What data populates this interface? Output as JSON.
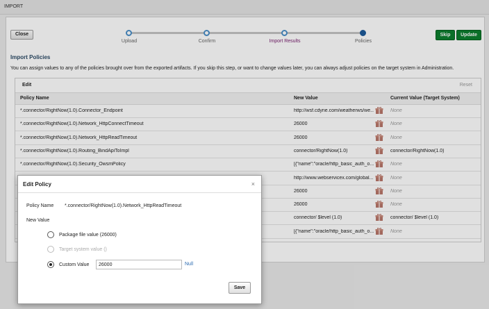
{
  "window": {
    "title": "IMPORT"
  },
  "toolbar": {
    "close_label": "Close",
    "skip_label": "Skip",
    "update_label": "Update"
  },
  "train": {
    "steps": [
      {
        "label": "Upload",
        "state": "done"
      },
      {
        "label": "Confirm",
        "state": "done"
      },
      {
        "label": "Import Results",
        "state": "visited"
      },
      {
        "label": "Policies",
        "state": "current"
      }
    ]
  },
  "section": {
    "title": "Import Policies",
    "description": "You can assign values to any of the policies brought over from the exported artifacts. If you skip this step, or want to change values later, you can always adjust policies on the target system in Administration."
  },
  "table": {
    "edit_label": "Edit",
    "reset_label": "Reset",
    "columns": [
      "Policy Name",
      "New Value",
      "Current Value (Target System)"
    ],
    "rows": [
      {
        "name": "*.connector/RightNow(1.0).Connector_Endpoint",
        "new_value": "http://wsf.cdyne.com/weatherws/we...",
        "current": "None",
        "current_is_none": true
      },
      {
        "name": "*.connector/RightNow(1.0).Network_HttpConnectTimeout",
        "new_value": "26000",
        "current": "None",
        "current_is_none": true
      },
      {
        "name": "*.connector/RightNow(1.0).Network_HttpReadTimeout",
        "new_value": "26000",
        "current": "None",
        "current_is_none": true
      },
      {
        "name": "*.connector/RightNow(1.0).Routing_BindApiToImpl",
        "new_value": "connector/RightNow(1.0)",
        "current": "connector/RightNow(1.0)",
        "current_is_none": false
      },
      {
        "name": "*.connector/RightNow(1.0).Security_OwsmPolicy",
        "new_value": "[{\"name\":\"oracle/http_basic_auth_o...",
        "current": "None",
        "current_is_none": true
      },
      {
        "name": "",
        "new_value": "http://www.webservicex.com/global...",
        "current": "None",
        "current_is_none": true
      },
      {
        "name": "",
        "new_value": "26000",
        "current": "None",
        "current_is_none": true
      },
      {
        "name": "",
        "new_value": "26000",
        "current": "None",
        "current_is_none": true
      },
      {
        "name": "",
        "new_value": "connector/ $level (1.0)",
        "current": "connector/ $level (1.0)",
        "current_is_none": false
      },
      {
        "name": "",
        "new_value": "[{\"name\":\"oracle/http_basic_auth_o...",
        "current": "None",
        "current_is_none": true
      }
    ]
  },
  "dialog": {
    "title": "Edit Policy",
    "close_glyph": "×",
    "policy_name_label": "Policy Name",
    "policy_name_value": "*.connector/RightNow(1.0).Network_HttpReadTimeout",
    "new_value_label": "New Value",
    "options": [
      {
        "label": "Package file value (26000)",
        "selected": false,
        "enabled": true
      },
      {
        "label": "Target system value ()",
        "selected": false,
        "enabled": false
      },
      {
        "label": "Custom Value",
        "selected": true,
        "enabled": true
      }
    ],
    "custom_value": "26000",
    "null_link": "Null",
    "save_label": "Save"
  },
  "colors": {
    "accent_green": "#0c7f2e",
    "train_current": "#1d5a9a",
    "link": "#2a6ab0"
  },
  "icons": {
    "row_action": "gift-icon"
  }
}
